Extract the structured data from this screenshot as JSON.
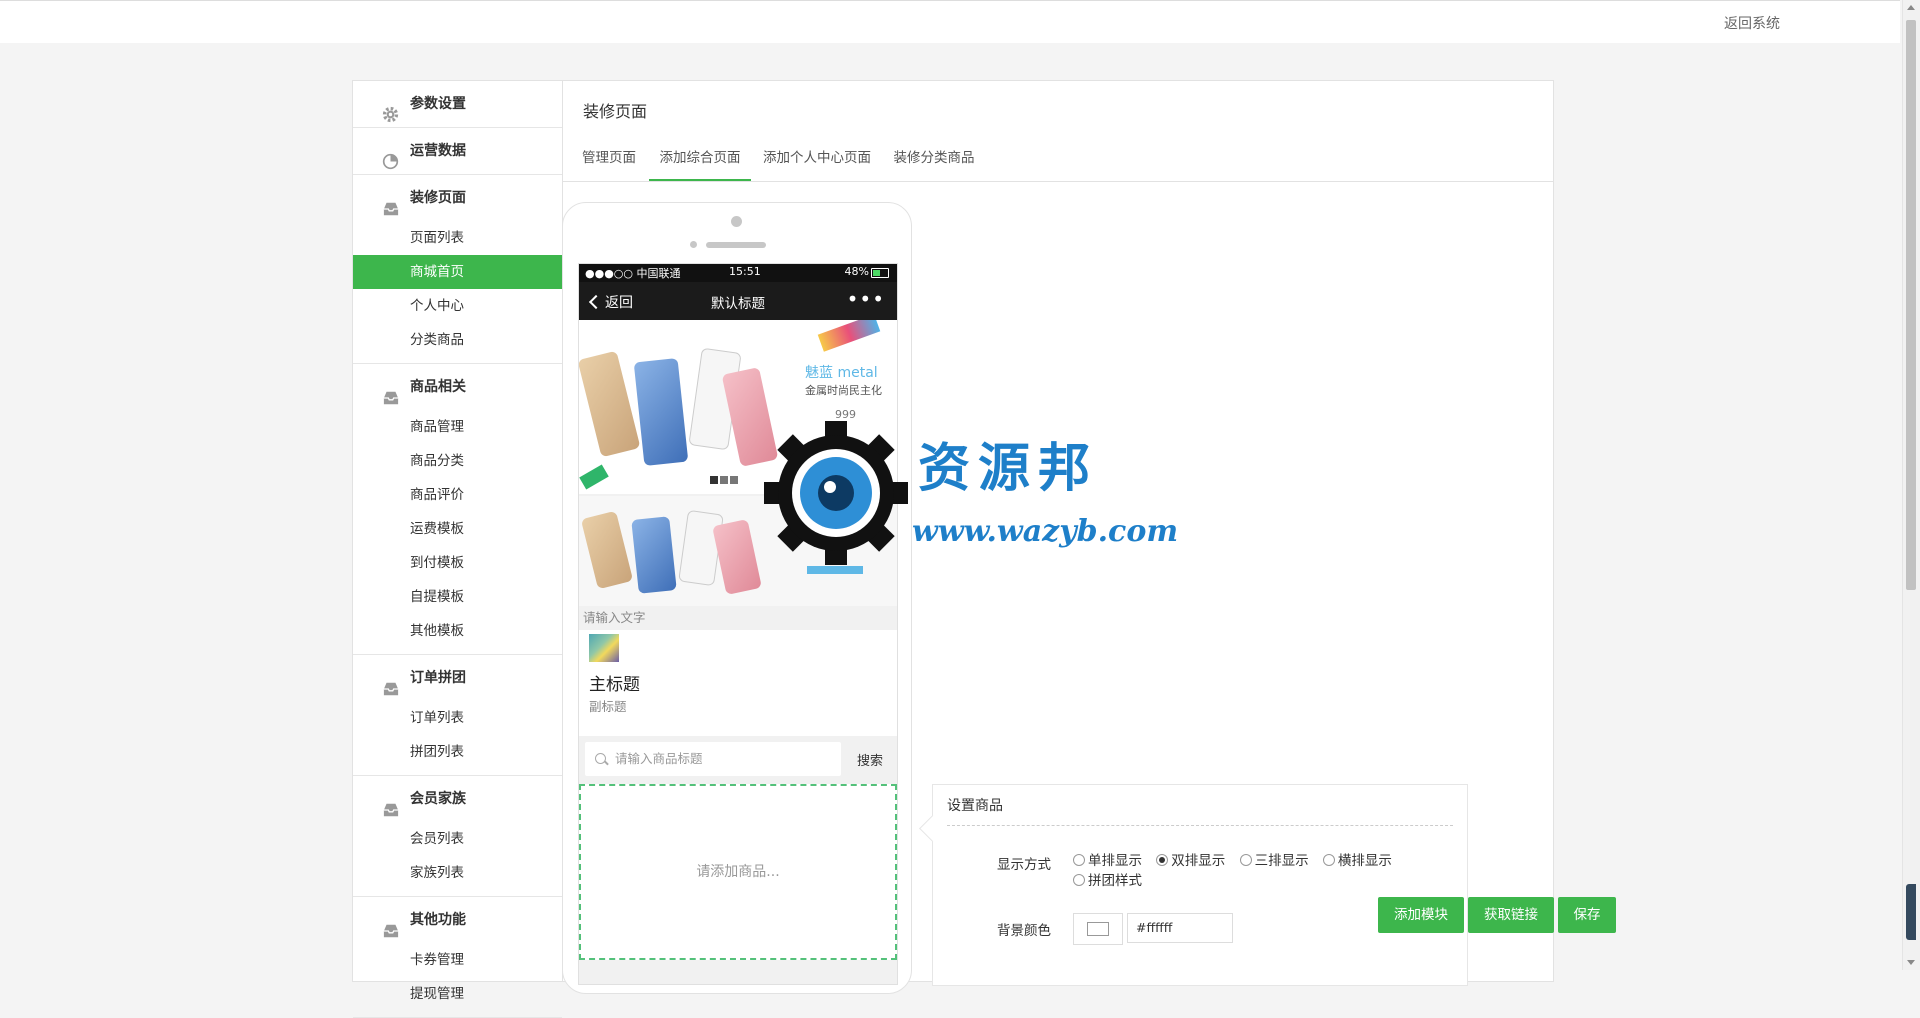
{
  "topbar": {
    "back_system": "返回系统"
  },
  "sidebar": {
    "groups": [
      {
        "label": "参数设置",
        "icon": "gear-icon",
        "items": []
      },
      {
        "label": "运营数据",
        "icon": "pie-chart-icon",
        "items": []
      },
      {
        "label": "装修页面",
        "icon": "inbox-icon",
        "items": [
          "页面列表",
          "商城首页",
          "个人中心",
          "分类商品"
        ],
        "active": "商城首页"
      },
      {
        "label": "商品相关",
        "icon": "inbox-icon",
        "items": [
          "商品管理",
          "商品分类",
          "商品评价",
          "运费模板",
          "到付模板",
          "自提模板",
          "其他模板"
        ]
      },
      {
        "label": "订单拼团",
        "icon": "inbox-icon",
        "items": [
          "订单列表",
          "拼团列表"
        ]
      },
      {
        "label": "会员家族",
        "icon": "inbox-icon",
        "items": [
          "会员列表",
          "家族列表"
        ]
      },
      {
        "label": "其他功能",
        "icon": "inbox-icon",
        "items": [
          "卡券管理",
          "提现管理"
        ]
      }
    ]
  },
  "content": {
    "title": "装修页面",
    "tabs": [
      "管理页面",
      "添加综合页面",
      "添加个人中心页面",
      "装修分类商品"
    ],
    "active_tab": "添加综合页面"
  },
  "phone": {
    "status": {
      "carrier": "●●●○○ 中国联通",
      "time": "15:51",
      "battery": "48%"
    },
    "nav": {
      "back": "返回",
      "title": "默认标题",
      "more": "•••"
    },
    "banner": {
      "brand": "魅蓝 metal",
      "slogan": "金属时尚民主化",
      "price": "999"
    },
    "text_hint": "请输入文字",
    "title_block": {
      "main": "主标题",
      "sub": "副标题"
    },
    "search": {
      "placeholder": "请输入商品标题",
      "button": "搜索"
    },
    "goods_placeholder": "请添加商品..."
  },
  "watermark": {
    "text1": "资源邦",
    "text2": "www.wazyb.com"
  },
  "settings": {
    "title": "设置商品",
    "display_label": "显示方式",
    "display_options": [
      "单排显示",
      "双排显示",
      "三排显示",
      "横排显示",
      "拼团样式"
    ],
    "display_selected": "双排显示",
    "bg_label": "背景颜色",
    "bg_value": "#ffffff"
  },
  "actions": {
    "add_module": "添加模块",
    "get_link": "获取链接",
    "save": "保存"
  },
  "colors": {
    "accent": "#3db64c",
    "watermark": "#1e7fc9",
    "nav_dark": "#1b1b1b"
  }
}
